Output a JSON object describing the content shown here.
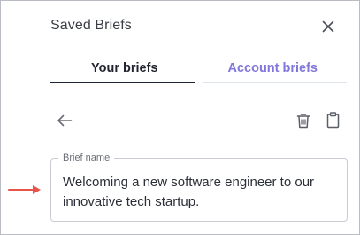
{
  "dialog": {
    "title": "Saved Briefs"
  },
  "tabs": [
    {
      "label": "Your briefs",
      "active": true
    },
    {
      "label": "Account briefs",
      "active": false
    }
  ],
  "toolbar": {
    "back_icon": "arrow-left-icon",
    "delete_icon": "trash-icon",
    "copy_icon": "clipboard-icon"
  },
  "brief_field": {
    "label": "Brief name",
    "value": "Welcoming a new software engineer to our innovative tech startup."
  },
  "colors": {
    "active_tab_underline": "#1e2533",
    "inactive_tab_text": "#7f77dd",
    "annotation_arrow": "#e8534a"
  }
}
